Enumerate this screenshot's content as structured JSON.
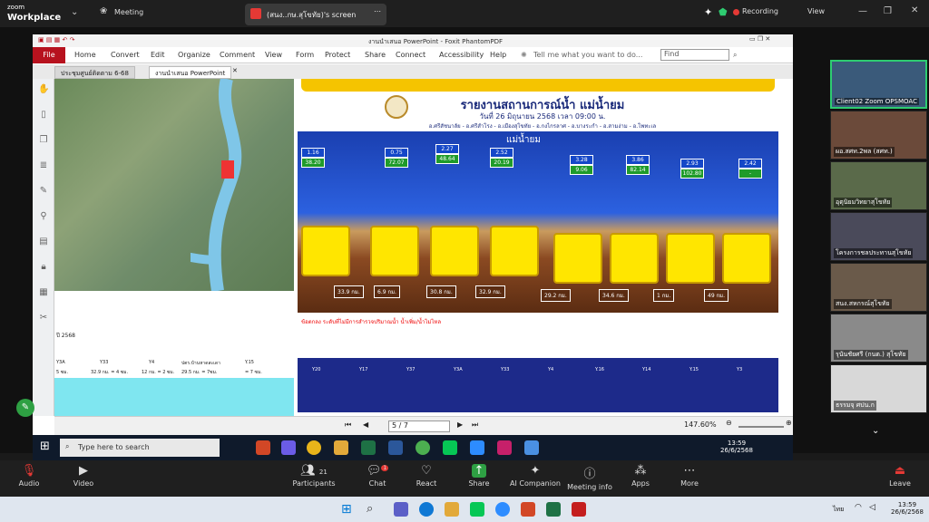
{
  "zoom_top": {
    "logo_line1": "zoom",
    "logo_line2": "Workplace",
    "meeting": "Meeting",
    "share_tab": "(สนง..กษ.สุโขทัย)'s screen",
    "recording": "Recording",
    "view": "View"
  },
  "pdf": {
    "title": "งานนำเสนอ PowerPoint - Foxit PhantomPDF",
    "menu": [
      "Home",
      "Convert",
      "Edit",
      "Organize",
      "Comment",
      "View",
      "Form",
      "Protect",
      "Share",
      "Connect",
      "Accessibility",
      "Help"
    ],
    "file": "File",
    "tellme": "Tell me what you want to do...",
    "find": "Find",
    "tabs": [
      "ประชุมศูนย์ติดตาม 6-68",
      "งานนำเสนอ PowerPoint"
    ],
    "page_value": "5 / 7",
    "zoom": "147.60%"
  },
  "slide": {
    "title": "รายงานสถานการณ์น้ำ แม่น้ำยม",
    "subtitle": "วันที่ 26 มิถุนายน 2568 เวลา 09:00 น.",
    "districts": "อ.ศรีสัชนาลัย - อ.ศรีสำโรง - อ.เมืองสุโขทัย - อ.กงไกรลาศ - อ.บางระกำ - อ.สามง่าม - อ.โพทะเล",
    "river_name": "แม่น้ำยม",
    "stations": [
      {
        "t": "1.16",
        "v": "38.20"
      },
      {
        "t": "0.75",
        "v": "72.07"
      },
      {
        "t": "2.27",
        "v": "48.64"
      },
      {
        "t": "2.52",
        "v": "20.19"
      },
      {
        "t": "3.28",
        "v": "9.06"
      },
      {
        "t": "3.86",
        "v": "82.14"
      },
      {
        "t": "2.93",
        "v": "102.80"
      },
      {
        "t": "2.42",
        "v": "-"
      }
    ],
    "bottom_labels": [
      "33.9 กม.",
      "6.9 กม.",
      "30.8 กม.",
      "32.9 กม.",
      "29.2 กม.",
      "34.6 กม.",
      "1 กม.",
      "49 กม."
    ],
    "legend": "ข้อตกลง  ระดับที่ไม่มีการสำรวจปริมาณน้ำ  น้ำเพิ่ม/น้ำไม่ไหล",
    "table_row": [
      "Y20",
      "Y17",
      "Y37",
      "Y3A",
      "Y33",
      "Y4",
      "Y.16",
      "Y14",
      "Y.15",
      "Y3"
    ]
  },
  "left_table": {
    "year": "ปี 2568",
    "cols": [
      "Y3A",
      "Y33",
      "Y4",
      "ปตร.บ้านหาดสะเดา",
      "Y.15"
    ],
    "vals": [
      "5 ซม.",
      "32.9 กม. = 4 ซม.",
      "12 กม. = 2 ซม.",
      "29.5 กม. = 7ซม.",
      "= 7 ซม."
    ]
  },
  "win_inner": {
    "search": "Type here to search",
    "time": "13:59",
    "date": "26/6/2568"
  },
  "participants": [
    {
      "name": "Client02 Zoom OPSMOAC"
    },
    {
      "name": "ผอ.สศท.2พล (สศท.)"
    },
    {
      "name": "อุตุนิยมวิทยาสุโขทัย"
    },
    {
      "name": "โครงการชลประทานสุโขทัย"
    },
    {
      "name": "สนง.สหกรณ์สุโขทัย"
    },
    {
      "name": "รุนันชัยศรี (กนต.) สุโขทัย"
    },
    {
      "name": "ธรรมจุ ศปน.ก"
    }
  ],
  "zoom_bottom": {
    "audio": "Audio",
    "video": "Video",
    "participants": "Participants",
    "participants_count": "21",
    "chat": "Chat",
    "chat_badge": "1",
    "react": "React",
    "share": "Share",
    "ai": "AI Companion",
    "info": "Meeting info",
    "apps": "Apps",
    "more": "More",
    "leave": "Leave"
  },
  "win_outer": {
    "time": "13:59",
    "date": "26/6/2568",
    "lang": "ไทย"
  }
}
